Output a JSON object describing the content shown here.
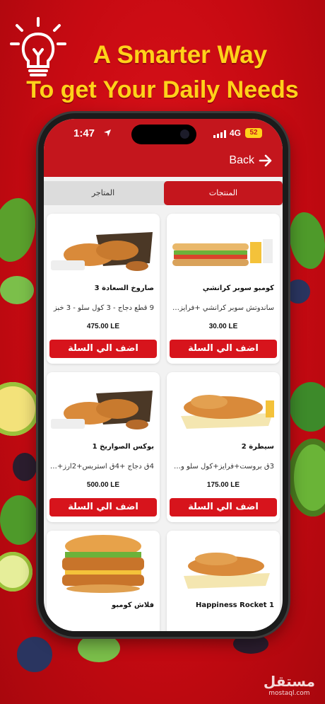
{
  "headline": {
    "line1": "A Smarter Way",
    "line2": "To get Your Daily Needs"
  },
  "status_bar": {
    "time": "1:47",
    "network": "4G",
    "battery": "52"
  },
  "header": {
    "back_label": "Back"
  },
  "tabs": {
    "products": "المنتجات",
    "stores": "المتاجر"
  },
  "products": [
    {
      "name": "كومبو سوبر كرانشي",
      "description": "ساندوتش سوبر كرانشي +فرايز+...",
      "price": "30.00 LE",
      "add_label": "اضف الي السلة"
    },
    {
      "name": "صاروخ السعادة 3",
      "description": "9 قطع دجاج - 3 كول سلو - 3 خبز",
      "price": "475.00 LE",
      "add_label": "اضف الي السلة"
    },
    {
      "name": "سيطرة 2",
      "description": "3ق بروست+فرايز+كول سلو وسط...",
      "price": "175.00 LE",
      "add_label": "اضف الي السلة"
    },
    {
      "name": "بوكس الصواريخ 1",
      "description": "4ق دجاج +4ق استربس+2ارز+2كو...",
      "price": "500.00 LE",
      "add_label": "اضف الي السلة"
    },
    {
      "name": "Happiness Rocket 1",
      "description": "",
      "price": "",
      "add_label": ""
    },
    {
      "name": "فلاش كومبو",
      "description": "",
      "price": "",
      "add_label": ""
    }
  ],
  "watermark": {
    "arabic": "مستقل",
    "latin": "mostaql.com"
  },
  "colors": {
    "brand_red": "#c4161d",
    "headline_yellow": "#ffd21a"
  }
}
